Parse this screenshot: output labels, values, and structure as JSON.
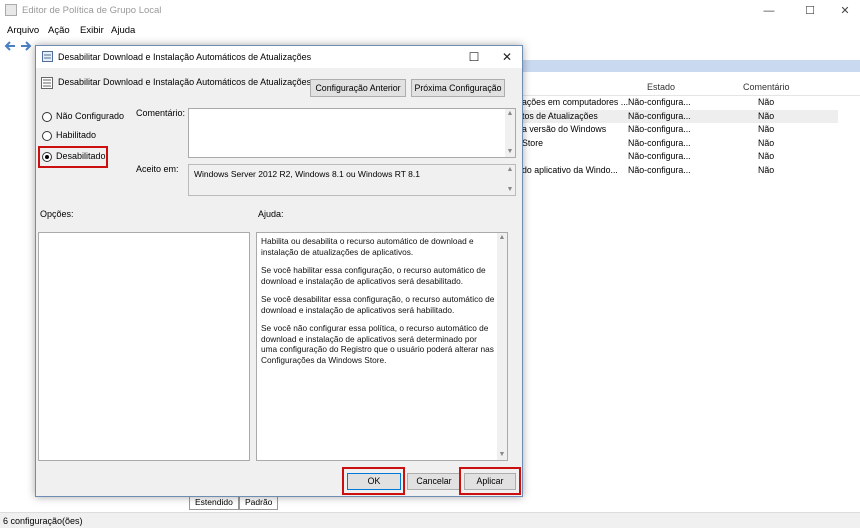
{
  "main_window": {
    "title": "Editor de Política de Grupo Local",
    "controls": {
      "minimize": "—",
      "maximize": "☐",
      "close": "✕"
    },
    "menu": [
      "Arquivo",
      "Ação",
      "Exibir",
      "Ajuda"
    ],
    "list": {
      "columns": {
        "state": "Estado",
        "comment": "Comentário"
      },
      "rows": [
        {
          "setting": "ações em computadores ...",
          "state": "Não-configura...",
          "comment": "Não"
        },
        {
          "setting": "tos de Atualizações",
          "state": "Não-configura...",
          "comment": "Não"
        },
        {
          "setting": "a versão do Windows",
          "state": "Não-configura...",
          "comment": "Não"
        },
        {
          "setting": "Store",
          "state": "Não-configura...",
          "comment": "Não"
        },
        {
          "setting": "",
          "state": "Não-configura...",
          "comment": "Não"
        },
        {
          "setting": "do aplicativo da Windo...",
          "state": "Não-configura...",
          "comment": "Não"
        }
      ]
    },
    "tabs": [
      "Estendido",
      "Padrão"
    ],
    "status": "6 configuração(ões)"
  },
  "dialog": {
    "title": "Desabilitar Download e Instalação Automáticos de Atualizações",
    "policy_name": "Desabilitar Download e Instalação Automáticos de Atualizações",
    "prev_button": "Configuração Anterior",
    "next_button": "Próxima Configuração",
    "radios": [
      {
        "label": "Não Configurado",
        "checked": false
      },
      {
        "label": "Habilitado",
        "checked": false
      },
      {
        "label": "Desabilitado",
        "checked": true
      }
    ],
    "comment_label": "Comentário:",
    "comment_value": "",
    "supported_label": "Aceito em:",
    "supported_value": "Windows Server 2012 R2, Windows 8.1 ou Windows RT 8.1",
    "options_label": "Opções:",
    "help_label": "Ajuda:",
    "help_paragraphs": [
      "Habilita ou desabilita o recurso automático de download e instalação de atualizações de aplicativos.",
      "Se você habilitar essa configuração, o recurso automático de download e instalação de aplicativos será desabilitado.",
      "Se você desabilitar essa configuração, o recurso automático de download e instalação de aplicativos será habilitado.",
      "Se você não configurar essa política, o recurso automático de download e instalação de aplicativos será determinado por uma configuração do Registro que o usuário poderá alterar nas Configurações da Windows Store."
    ],
    "ok_button": "OK",
    "cancel_button": "Cancelar",
    "apply_button": "Aplicar"
  },
  "colors": {
    "highlight": "#cc1010",
    "selection": "#c9daf0"
  }
}
